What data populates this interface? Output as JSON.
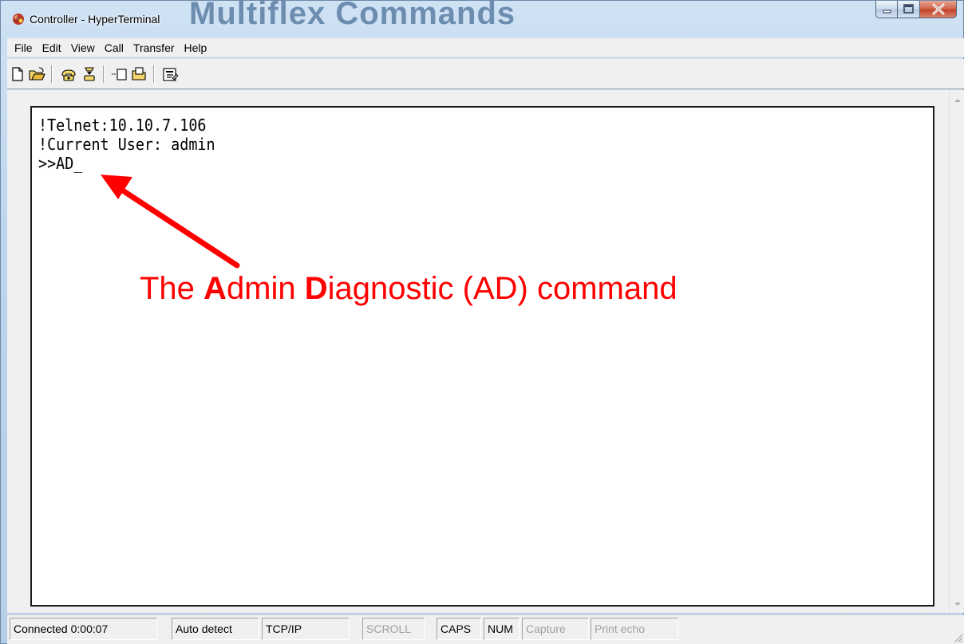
{
  "window": {
    "title": "Controller - HyperTerminal",
    "background_slide_title": "Multiflex Commands"
  },
  "menu": [
    "File",
    "Edit",
    "View",
    "Call",
    "Transfer",
    "Help"
  ],
  "toolbar_icons": [
    "new-connection-icon",
    "open-icon",
    "connect-icon",
    "disconnect-icon",
    "send-icon",
    "receive-icon",
    "properties-icon"
  ],
  "terminal": {
    "lines": [
      "!Telnet:10.10.7.106",
      "!Current User: admin",
      ">>AD_"
    ]
  },
  "annotation": {
    "part1": "The ",
    "bold_a": "A",
    "part2": "dmin ",
    "bold_d": "D",
    "part3": "iagnostic (AD) command",
    "color": "#ff0000"
  },
  "status": {
    "connection": "Connected 0:00:07",
    "detect": "Auto detect",
    "protocol": "TCP/IP",
    "scroll": "SCROLL",
    "caps": "CAPS",
    "num": "NUM",
    "capture": "Capture",
    "print_echo": "Print echo"
  }
}
